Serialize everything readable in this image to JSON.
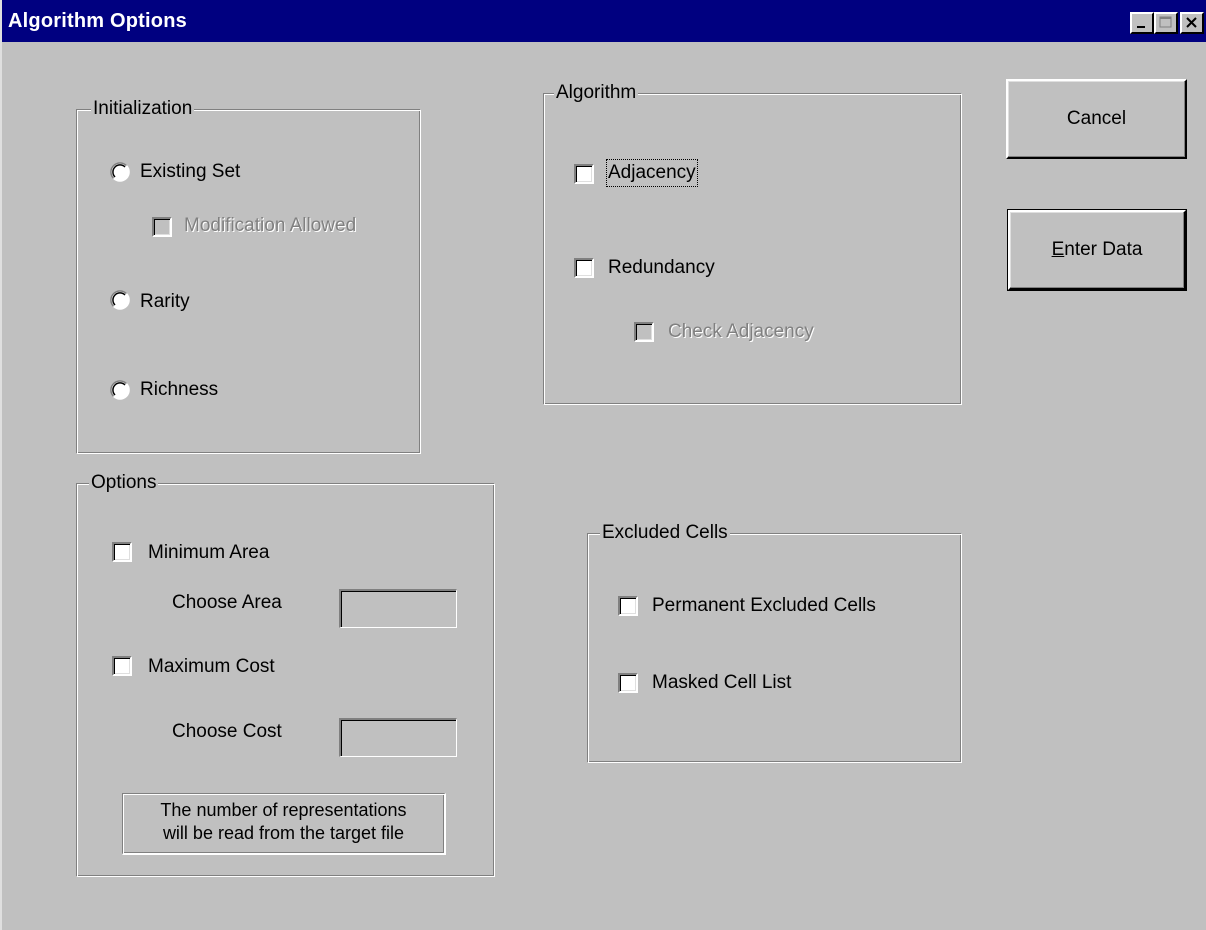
{
  "window": {
    "title": "Algorithm Options",
    "controls": {
      "minimize": "minimize-icon",
      "maximize": "maximize-icon",
      "close": "close-icon"
    }
  },
  "initialization": {
    "label": "Initialization",
    "existing_set": "Existing Set",
    "modification_allowed": "Modification Allowed",
    "rarity": "Rarity",
    "richness": "Richness"
  },
  "algorithm": {
    "label": "Algorithm",
    "adjacency": "Adjacency",
    "redundancy": "Redundancy",
    "check_adjacency": "Check Adjacency"
  },
  "options": {
    "label": "Options",
    "minimum_area": "Minimum Area",
    "choose_area": "Choose Area",
    "choose_area_value": "",
    "maximum_cost": "Maximum Cost",
    "choose_cost": "Choose Cost",
    "choose_cost_value": "",
    "note_line1": "The number of representations",
    "note_line2": "will be read from the target file"
  },
  "excluded_cells": {
    "label": "Excluded Cells",
    "permanent": "Permanent Excluded Cells",
    "masked": "Masked Cell List"
  },
  "buttons": {
    "cancel": "Cancel",
    "enter_data_mnemonic": "E",
    "enter_data_rest": "nter Data"
  },
  "colors": {
    "titlebar": "#000080",
    "face": "#c0c0c0"
  }
}
